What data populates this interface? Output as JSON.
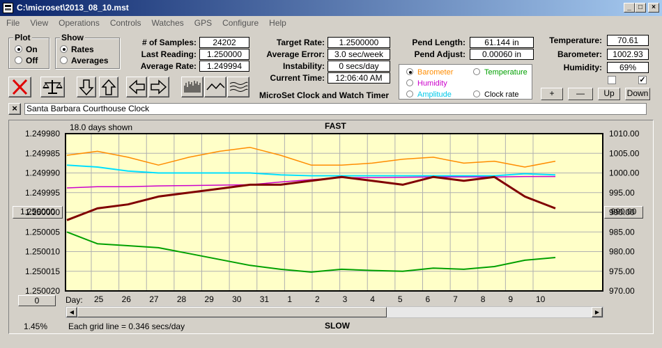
{
  "window": {
    "title": "C:\\microset\\2013_08_10.mst"
  },
  "menu": [
    "File",
    "View",
    "Operations",
    "Controls",
    "Watches",
    "GPS",
    "Configure",
    "Help"
  ],
  "plot_group": {
    "title": "Plot",
    "on": "On",
    "off": "Off",
    "selected": "On"
  },
  "show_group": {
    "title": "Show",
    "rates": "Rates",
    "averages": "Averages",
    "selected": "Rates"
  },
  "stats": {
    "samples_label": "# of Samples:",
    "samples": "24202",
    "last_label": "Last Reading:",
    "last": "1.250000",
    "avg_rate_label": "Average Rate:",
    "avg_rate": "1.249994"
  },
  "timer": {
    "target_label": "Target Rate:",
    "target": "1.2500000",
    "avg_err_label": "Average Error:",
    "avg_err": "3.0 sec/week",
    "instab_label": "Instability:",
    "instab": "0 secs/day",
    "time_label": "Current Time:",
    "time": "12:06:40 AM",
    "app_caption": "MicroSet Clock and Watch Timer"
  },
  "pend": {
    "length_label": "Pend Length:",
    "length": "61.144 in",
    "adjust_label": "Pend Adjust:",
    "adjust": "0.00060 in"
  },
  "env": {
    "temp_label": "Temperature:",
    "temp": "70.61",
    "baro_label": "Barometer:",
    "baro": "1002.93",
    "hum_label": "Humidity:",
    "hum": "69%"
  },
  "overlay": {
    "barometer": "Barometer",
    "temperature": "Temperature",
    "humidity": "Humidity",
    "amplitude": "Amplitude",
    "clockrate": "Clock rate",
    "selected": "Barometer"
  },
  "scale_buttons": {
    "plus": "+",
    "minus": "—",
    "up": "Up",
    "down": "Down"
  },
  "watch_name": "Santa Barbara Courthouse Clock",
  "chart": {
    "days_shown": "18.0 days shown",
    "fast": "FAST",
    "slow": "SLOW",
    "grid_note": "Each grid line = 0.346 secs/day",
    "percent": "1.45%",
    "left_button": "1.250000",
    "left_button2": "0",
    "right_button": "990.00",
    "day_label": "Day:"
  },
  "colors": {
    "rate": "#800000",
    "barometer": "#ff8c00",
    "temperature": "#00a000",
    "humidity": "#cc00cc",
    "amplitude": "#00e0ff",
    "plot_bg": "#ffffc8"
  },
  "chart_data": {
    "type": "line",
    "title": "",
    "x": [
      "25",
      "26",
      "27",
      "28",
      "29",
      "30",
      "31",
      "1",
      "2",
      "3",
      "4",
      "5",
      "6",
      "7",
      "8",
      "9",
      "10"
    ],
    "left_axis_ticks": [
      "1.249980",
      "1.249985",
      "1.249990",
      "1.249995",
      "1.250000",
      "1.250005",
      "1.250010",
      "1.250015",
      "1.250020"
    ],
    "right_axis_ticks": [
      "1010.00",
      "1005.00",
      "1000.00",
      "995.00",
      "990.00",
      "985.00",
      "980.00",
      "975.00",
      "970.00"
    ],
    "left_ylim": [
      1.24998,
      1.25002
    ],
    "right_ylim": [
      970,
      1010
    ],
    "left_axis_inverted": true,
    "series": [
      {
        "name": "Clock rate",
        "axis": "left",
        "values": [
          1.250002,
          1.249999,
          1.249998,
          1.249996,
          1.249995,
          1.249994,
          1.249993,
          1.249993,
          1.249992,
          1.249991,
          1.249992,
          1.249993,
          1.249991,
          1.249992,
          1.249991,
          1.249996,
          1.249999
        ]
      },
      {
        "name": "Barometer",
        "axis": "right",
        "values": [
          1004.5,
          1005.5,
          1004.0,
          1002.0,
          1004.0,
          1005.5,
          1006.5,
          1004.5,
          1002.0,
          1002.0,
          1002.5,
          1003.5,
          1004.0,
          1002.5,
          1003.0,
          1001.5,
          1003.0
        ]
      },
      {
        "name": "Temperature",
        "axis": "right",
        "values": [
          985.0,
          982.0,
          981.5,
          981.0,
          979.5,
          978.0,
          976.5,
          975.5,
          974.8,
          975.5,
          975.2,
          975.0,
          975.8,
          975.5,
          976.2,
          977.8,
          978.5
        ]
      },
      {
        "name": "Humidity",
        "axis": "right",
        "values": [
          996.2,
          996.5,
          996.5,
          996.7,
          996.8,
          996.9,
          997.0,
          997.7,
          998.3,
          998.8,
          998.8,
          998.9,
          999.0,
          999.0,
          999.0,
          999.1,
          999.1
        ]
      },
      {
        "name": "Amplitude",
        "axis": "right",
        "values": [
          1002.0,
          1001.5,
          1000.5,
          1000.0,
          1000.0,
          1000.0,
          1000.0,
          999.5,
          999.3,
          999.3,
          999.3,
          999.3,
          999.3,
          999.3,
          999.3,
          999.8,
          999.5
        ]
      }
    ]
  }
}
